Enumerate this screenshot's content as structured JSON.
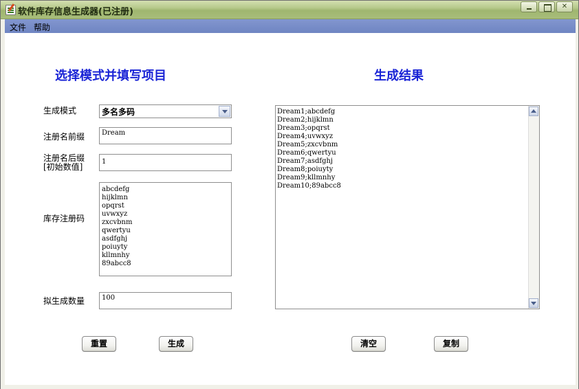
{
  "window": {
    "title": "软件库存信息生成器(已注册)"
  },
  "menu": {
    "file": "文件",
    "help": "帮助"
  },
  "left": {
    "heading": "选择模式并填写项目",
    "mode_label": "生成模式",
    "mode_value": "多名多码",
    "prefix_label": "注册名前缀",
    "prefix_value": "Dream",
    "suffix_label_line1": "注册名后缀",
    "suffix_label_line2": "[初始数值]",
    "suffix_value": "1",
    "codes_label": "库存注册码",
    "codes_value": "abcdefg\nhijklmn\nopqrst\nuvwxyz\nzxcvbnm\nqwertyu\nasdfghj\npoiuyty\nkllmnhy\n89abcc8",
    "count_label": "拟生成数量",
    "count_value": "100",
    "reset_button": "重置",
    "generate_button": "生成"
  },
  "right": {
    "heading": "生成结果",
    "result_text": "Dream1;abcdefg\nDream2;hijklmn\nDream3;opqrst\nDream4;uvwxyz\nDream5;zxcvbnm\nDream6;qwertyu\nDream7;asdfghj\nDream8;poiuyty\nDream9;kllmnhy\nDream10;89abcc8",
    "clear_button": "清空",
    "copy_button": "复制"
  },
  "colors": {
    "heading": "#1a24d6",
    "menubar": "#7a8fc9",
    "titlebar": "#b6c98b"
  }
}
